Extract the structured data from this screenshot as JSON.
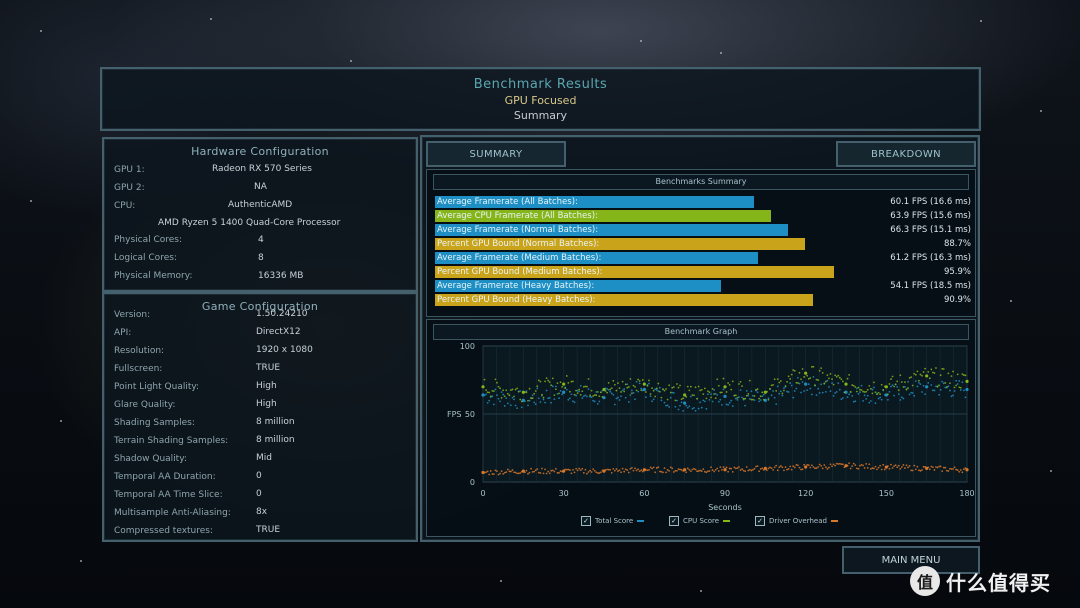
{
  "header": {
    "title": "Benchmark Results",
    "subtitle": "GPU Focused",
    "view": "Summary"
  },
  "hardware": {
    "title": "Hardware Configuration",
    "rows": [
      {
        "label": "GPU 1:",
        "value": "Radeon RX 570 Series"
      },
      {
        "label": "GPU 2:",
        "value": "NA"
      },
      {
        "label": "CPU:",
        "value": "AuthenticAMD"
      },
      {
        "label": "",
        "value": "AMD Ryzen 5 1400 Quad-Core Processor"
      },
      {
        "label": "Physical Cores:",
        "value": "4"
      },
      {
        "label": "Logical Cores:",
        "value": "8"
      },
      {
        "label": "Physical Memory:",
        "value": "16336  MB"
      }
    ]
  },
  "game": {
    "title": "Game Configuration",
    "rows": [
      {
        "label": "Version:",
        "value": "1.50.24210"
      },
      {
        "label": "API:",
        "value": "DirectX12"
      },
      {
        "label": "Resolution:",
        "value": "1920 x 1080"
      },
      {
        "label": "Fullscreen:",
        "value": "TRUE"
      },
      {
        "label": "Point Light Quality:",
        "value": "High"
      },
      {
        "label": "Glare Quality:",
        "value": "High"
      },
      {
        "label": "Shading Samples:",
        "value": "8 million"
      },
      {
        "label": "Terrain Shading Samples:",
        "value": "8 million"
      },
      {
        "label": "Shadow Quality:",
        "value": "Mid"
      },
      {
        "label": "Temporal AA Duration:",
        "value": "0"
      },
      {
        "label": "Temporal AA Time Slice:",
        "value": "0"
      },
      {
        "label": "Multisample Anti-Aliasing:",
        "value": "8x"
      },
      {
        "label": "Compressed textures:",
        "value": "TRUE"
      }
    ]
  },
  "tabs": {
    "summary": "SUMMARY",
    "breakdown": "BREAKDOWN"
  },
  "summary": {
    "title": "Benchmarks Summary",
    "colors": {
      "framerate": "#1d8fc4",
      "cpu": "#86b51a",
      "bound": "#c9a31a"
    },
    "bars": [
      {
        "label": "Average Framerate (All Batches):",
        "value": "60.1 FPS (16.6 ms)",
        "fill": 0.76,
        "kind": "framerate"
      },
      {
        "label": "Average CPU Framerate (All Batches):",
        "value": "63.9 FPS (15.6 ms)",
        "fill": 0.8,
        "kind": "cpu"
      },
      {
        "label": "Average Framerate (Normal Batches):",
        "value": "66.3 FPS (15.1 ms)",
        "fill": 0.84,
        "kind": "framerate"
      },
      {
        "label": "Percent GPU Bound (Normal Batches):",
        "value": "88.7%",
        "fill": 0.88,
        "kind": "bound"
      },
      {
        "label": "Average Framerate (Medium Batches):",
        "value": "61.2 FPS (16.3 ms)",
        "fill": 0.77,
        "kind": "framerate"
      },
      {
        "label": "Percent GPU Bound (Medium Batches):",
        "value": "95.9%",
        "fill": 0.95,
        "kind": "bound"
      },
      {
        "label": "Average Framerate (Heavy Batches):",
        "value": "54.1 FPS (18.5 ms)",
        "fill": 0.68,
        "kind": "framerate"
      },
      {
        "label": "Percent GPU Bound (Heavy Batches):",
        "value": "90.9%",
        "fill": 0.9,
        "kind": "bound"
      }
    ]
  },
  "graph": {
    "title": "Benchmark Graph",
    "ylabel": "FPS",
    "xlabel": "Seconds",
    "xticks": [
      "0",
      "30",
      "60",
      "90",
      "120",
      "150",
      "180"
    ],
    "yticks": [
      "100",
      "50",
      "0"
    ],
    "legend": [
      {
        "label": "Total Score",
        "color": "#1d8fc4",
        "checked": "✓"
      },
      {
        "label": "CPU Score",
        "color": "#86b51a",
        "checked": "✓"
      },
      {
        "label": "Driver Overhead",
        "color": "#d9782a",
        "checked": "✓"
      }
    ]
  },
  "chart_data": {
    "type": "scatter",
    "title": "Benchmark Graph",
    "xlabel": "Seconds",
    "ylabel": "FPS",
    "xlim": [
      0,
      180
    ],
    "ylim": [
      0,
      100
    ],
    "series": [
      {
        "name": "Total Score",
        "x": [
          0,
          15,
          30,
          45,
          60,
          75,
          90,
          105,
          120,
          135,
          150,
          165,
          180
        ],
        "values": [
          64,
          60,
          66,
          62,
          68,
          58,
          63,
          60,
          72,
          66,
          64,
          70,
          68
        ]
      },
      {
        "name": "CPU Score",
        "x": [
          0,
          15,
          30,
          45,
          60,
          75,
          90,
          105,
          120,
          135,
          150,
          165,
          180
        ],
        "values": [
          70,
          66,
          72,
          68,
          72,
          64,
          70,
          66,
          80,
          72,
          70,
          78,
          74
        ]
      },
      {
        "name": "Driver Overhead",
        "x": [
          0,
          15,
          30,
          45,
          60,
          75,
          90,
          105,
          120,
          135,
          150,
          165,
          180
        ],
        "values": [
          7,
          8,
          8,
          8,
          9,
          9,
          9,
          10,
          11,
          12,
          11,
          10,
          9
        ]
      }
    ]
  },
  "footer": {
    "main_menu": "MAIN MENU",
    "watermark": "什么值得买",
    "watermark_logo": "值"
  }
}
